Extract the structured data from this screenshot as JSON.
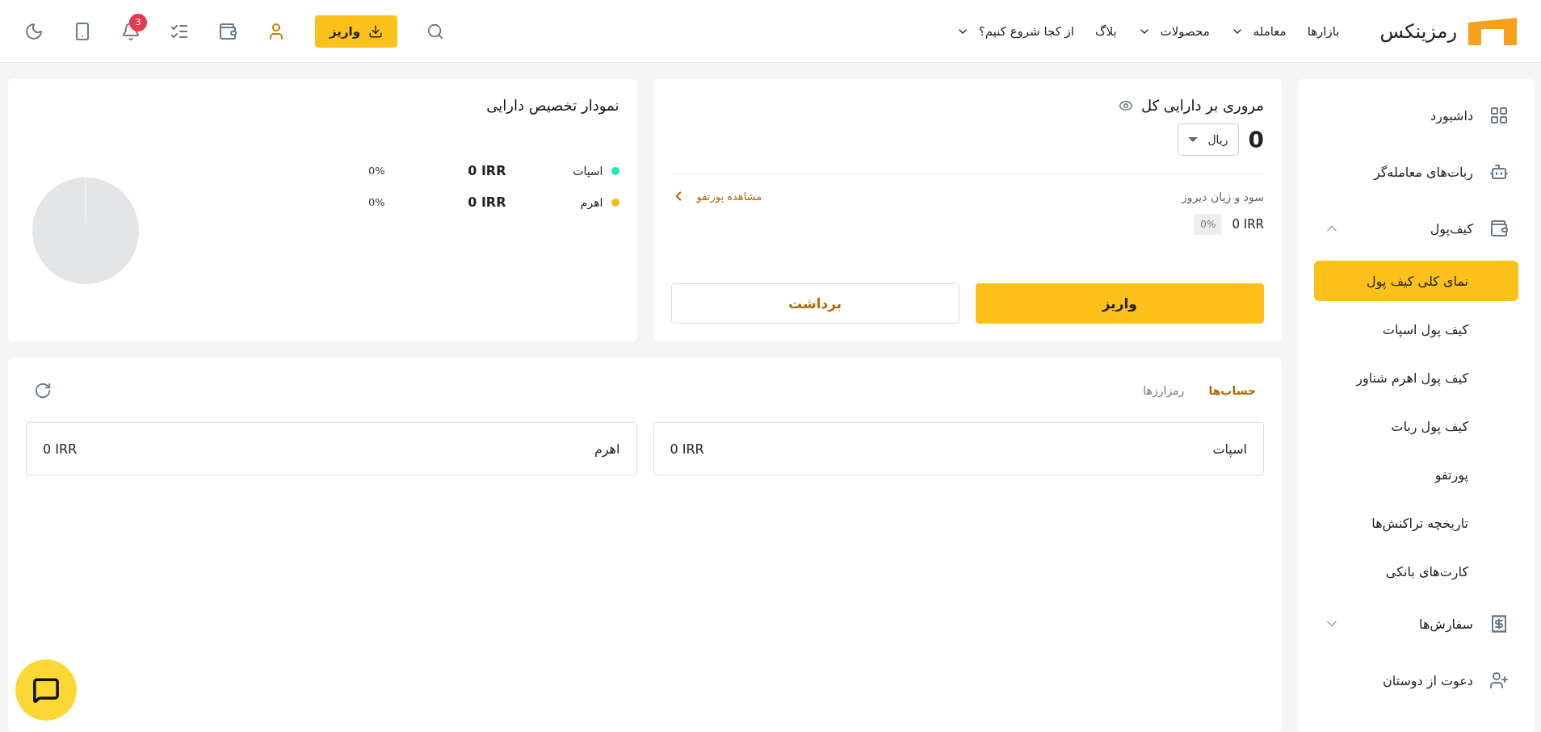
{
  "header": {
    "logo": "رمزینکس",
    "nav": [
      {
        "label": "بازارها",
        "has_menu": false
      },
      {
        "label": "معامله",
        "has_menu": true
      },
      {
        "label": "محصولات",
        "has_menu": true
      },
      {
        "label": "بلاگ",
        "has_menu": false
      },
      {
        "label": "از کجا شروع کنیم؟",
        "has_menu": true
      }
    ],
    "deposit_button": "واریز",
    "notification_count": "3"
  },
  "sidebar": {
    "items": [
      {
        "kind": "link",
        "label": "داشبورد"
      },
      {
        "kind": "link",
        "label": "ربات‌های معامله‌گر"
      },
      {
        "kind": "group",
        "label": "کیف‌پول",
        "expanded": true,
        "children": [
          {
            "label": "نمای کلی کیف پول",
            "selected": true
          },
          {
            "label": "کیف پول اسپات",
            "selected": false
          },
          {
            "label": "کیف پول اهرم شناور",
            "selected": false
          },
          {
            "label": "کیف پول ربات",
            "selected": false
          },
          {
            "label": "پورتفو",
            "selected": false
          },
          {
            "label": "تاریخچه تراکنش‌ها",
            "selected": false
          },
          {
            "label": "کارت‌های بانکی",
            "selected": false
          }
        ]
      },
      {
        "kind": "group",
        "label": "سفارش‌ها",
        "expanded": false
      },
      {
        "kind": "link",
        "label": "دعوت از دوستان"
      }
    ]
  },
  "overview": {
    "title": "مروری بر دارایی کل",
    "total": "0",
    "currency": "ریال",
    "pnl_label": "سود و زیان دیروز",
    "pnl_value": "0 IRR",
    "pnl_percent": "0%",
    "portfolio_link": "مشاهده پورتفو",
    "buttons": [
      {
        "label": "واریز",
        "kind": "primary"
      },
      {
        "label": "برداشت",
        "kind": "secondary"
      }
    ]
  },
  "allocation": {
    "title": "نمودار تخصیص دارایی",
    "legend": [
      {
        "name": "اسپات",
        "color": "#1de9b6",
        "amount": "0 IRR",
        "percent": "0%"
      },
      {
        "name": "اهرم",
        "color": "#f5bd1e",
        "amount": "0 IRR",
        "percent": "0%"
      }
    ]
  },
  "accounts": {
    "tabs": [
      {
        "label": "حساب‌ها",
        "selected": true
      },
      {
        "label": "رمزارزها",
        "selected": false
      }
    ],
    "items": [
      {
        "name": "اسپات",
        "amount": "0 IRR"
      },
      {
        "name": "اهرم",
        "amount": "0 IRR"
      }
    ]
  }
}
